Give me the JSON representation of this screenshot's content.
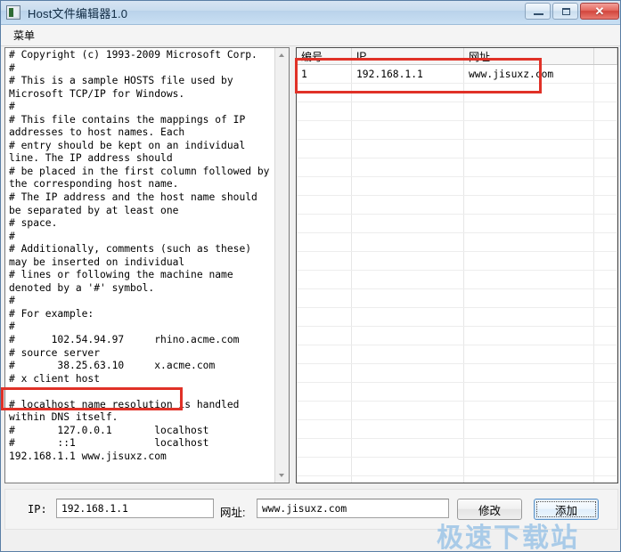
{
  "window": {
    "title": "Host文件编辑器1.0",
    "icon": "app-icon",
    "controls": {
      "minimize": "minimize-icon",
      "maximize": "maximize-icon",
      "close": "✕"
    }
  },
  "menubar": {
    "items": [
      {
        "label": "菜单"
      }
    ]
  },
  "editor": {
    "content": "# Copyright (c) 1993-2009 Microsoft Corp.\n#\n# This is a sample HOSTS file used by Microsoft TCP/IP for Windows.\n#\n# This file contains the mappings of IP addresses to host names. Each\n# entry should be kept on an individual line. The IP address should\n# be placed in the first column followed by the corresponding host name.\n# The IP address and the host name should be separated by at least one\n# space.\n#\n# Additionally, comments (such as these) may be inserted on individual\n# lines or following the machine name denoted by a '#' symbol.\n#\n# For example:\n#\n#      102.54.94.97     rhino.acme.com\n# source server\n#       38.25.63.10     x.acme.com\n# x client host\n\n# localhost name resolution is handled within DNS itself.\n#       127.0.0.1       localhost\n#       ::1             localhost\n192.168.1.1 www.jisuxz.com\n",
    "scrollbar": {
      "up_arrow": "scroll-up-icon",
      "down_arrow": "scroll-down-icon"
    }
  },
  "grid": {
    "columns": [
      "编号",
      "IP",
      "网址"
    ],
    "rows": [
      {
        "id": "1",
        "ip": "192.168.1.1",
        "url": "www.jisuxz.com"
      }
    ]
  },
  "form": {
    "ip_label": "IP:",
    "ip_value": "192.168.1.1",
    "url_label": "网址:",
    "url_value": "www.jisuxz.com",
    "modify_button": "修改",
    "add_button": "添加"
  },
  "watermark": {
    "text": "极速下载站",
    "color": "#a9cbe8"
  },
  "annotations": {
    "accent_color": "#e03127",
    "boxes": [
      {
        "name": "grid-row-highlight"
      },
      {
        "name": "hosts-entry-highlight"
      }
    ]
  }
}
